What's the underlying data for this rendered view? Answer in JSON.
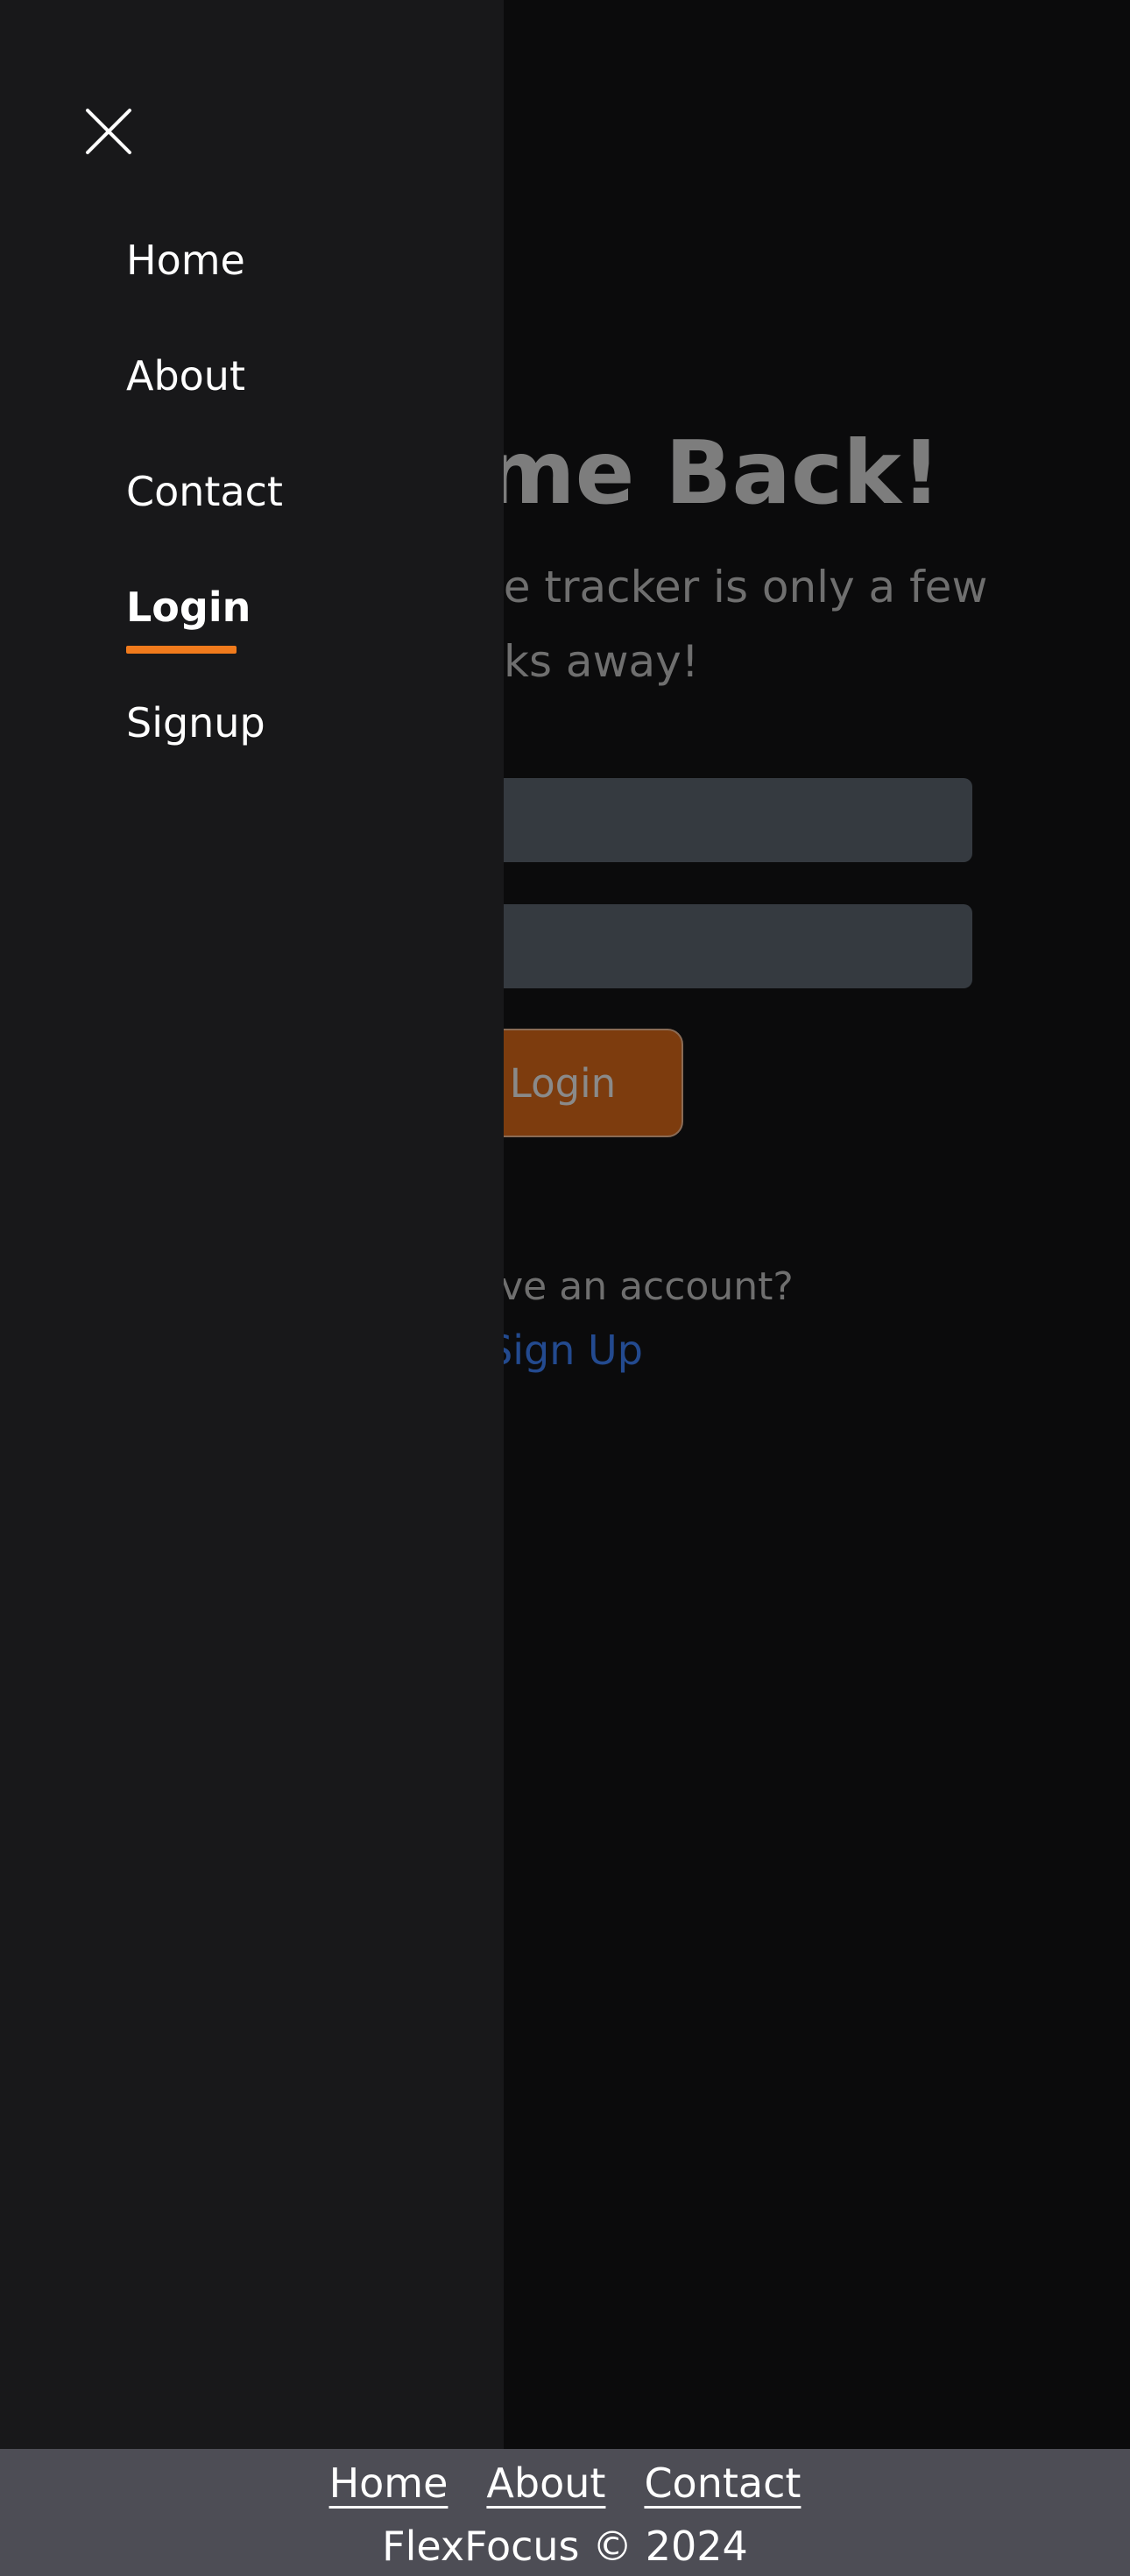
{
  "main": {
    "heading": "Welcome Back!",
    "subtext": "Your performance tracker is only a few clicks away!",
    "username_field": {
      "value": "",
      "placeholder": ""
    },
    "password_field": {
      "value": "",
      "placeholder": ""
    },
    "login_button_label": "Login",
    "no_account_text": "Don't have an account?",
    "signup_link_label": "Sign Up"
  },
  "drawer": {
    "close_icon": "close-icon",
    "items": [
      {
        "label": "Home",
        "active": false
      },
      {
        "label": "About",
        "active": false
      },
      {
        "label": "Contact",
        "active": false
      },
      {
        "label": "Login",
        "active": true
      },
      {
        "label": "Signup",
        "active": false
      }
    ]
  },
  "footer": {
    "links": [
      "Home",
      "About",
      "Contact"
    ],
    "copyright": "FlexFocus © 2024"
  },
  "colors": {
    "background": "#0b0b0c",
    "drawer_background": "#18181a",
    "accent": "#f07a1c",
    "login_button": "#7d3c0e",
    "link": "#234a8f",
    "footer_background": "#4d4d55",
    "input_background": "#353a40"
  }
}
